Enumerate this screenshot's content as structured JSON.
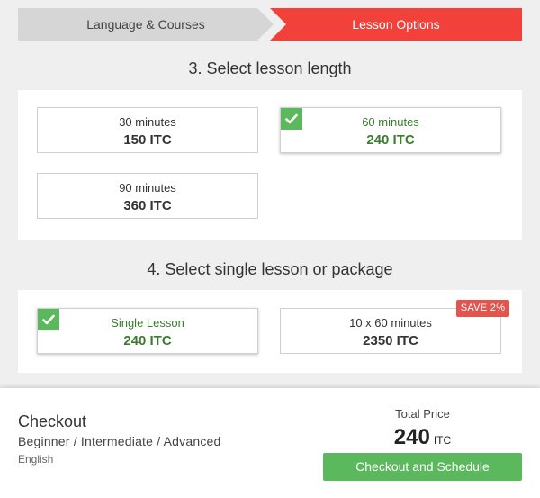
{
  "steps": [
    {
      "label": "Language & Courses"
    },
    {
      "label": "Lesson Options"
    }
  ],
  "length_section": {
    "title": "3. Select lesson length",
    "options": [
      {
        "label": "30 minutes",
        "price": "150 ITC",
        "selected": false
      },
      {
        "label": "60 minutes",
        "price": "240 ITC",
        "selected": true
      },
      {
        "label": "90 minutes",
        "price": "360 ITC",
        "selected": false
      }
    ]
  },
  "package_section": {
    "title": "4. Select single lesson or package",
    "options": [
      {
        "label": "Single Lesson",
        "price": "240 ITC",
        "selected": true
      },
      {
        "label": "10 x 60 minutes",
        "price": "2350 ITC",
        "selected": false,
        "badge": "SAVE 2%"
      }
    ]
  },
  "checkout": {
    "title": "Checkout",
    "level": "Beginner / Intermediate / Advanced",
    "language": "English",
    "total_label": "Total Price",
    "total_value": "240",
    "total_unit": "ITC",
    "button_label": "Checkout and Schedule"
  },
  "colors": {
    "active_step": "#f2403a",
    "inactive_step": "#d6d6d6",
    "selected_green": "#5cb85c",
    "badge_red": "#e0564f"
  },
  "icons": {
    "check": "checkmark-icon"
  }
}
